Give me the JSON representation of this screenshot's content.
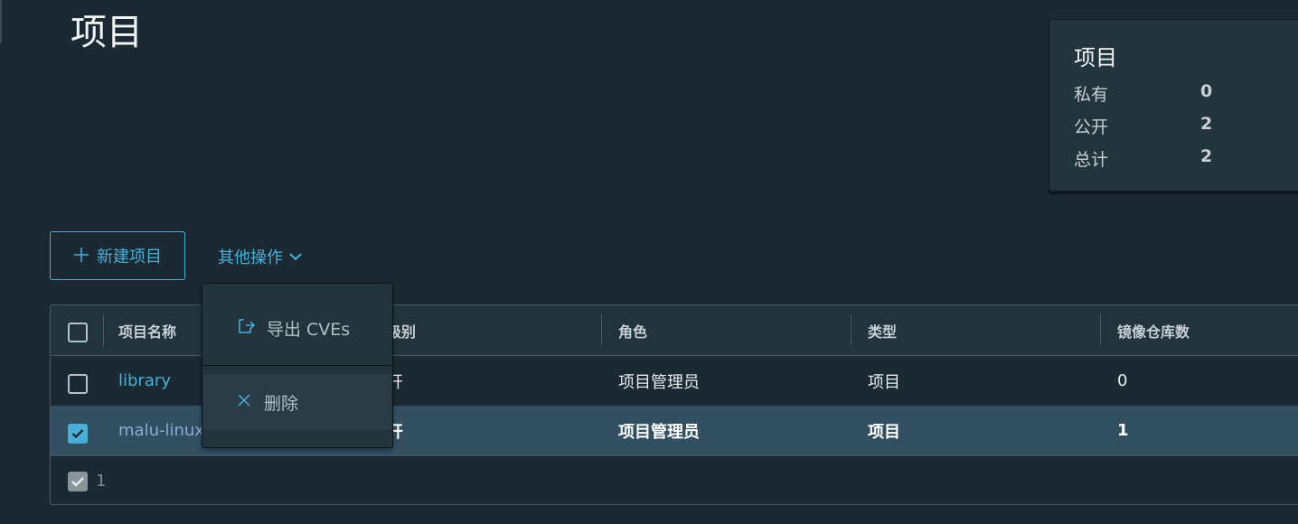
{
  "page": {
    "title": "项目"
  },
  "summary": {
    "title": "项目",
    "rows": [
      {
        "label": "私有",
        "value": "0"
      },
      {
        "label": "公开",
        "value": "2"
      },
      {
        "label": "总计",
        "value": "2"
      }
    ]
  },
  "toolbar": {
    "new_project_label": "新建项目",
    "other_actions_label": "其他操作"
  },
  "dropdown": {
    "items": [
      {
        "label": "导出 CVEs",
        "icon": "export-icon"
      },
      {
        "label": "删除",
        "icon": "close-icon"
      }
    ]
  },
  "table": {
    "columns": [
      "项目名称",
      "访问级别",
      "角色",
      "类型",
      "镜像仓库数"
    ],
    "column_visible_fragments": [
      "项目名称",
      "级别",
      "角色",
      "类型",
      "镜像仓库数"
    ],
    "rows": [
      {
        "name": "library",
        "access": "公开",
        "access_visible": "开",
        "role": "项目管理员",
        "type": "项目",
        "repo_count": "0",
        "selected": false
      },
      {
        "name": "malu-linux",
        "access": "公开",
        "access_visible": "开",
        "role": "项目管理员",
        "type": "项目",
        "repo_count": "1",
        "selected": true
      }
    ],
    "footer_selected_count": "1"
  },
  "colors": {
    "accent": "#49afd9",
    "background": "#1b2a32",
    "selected_row": "#324f61"
  }
}
